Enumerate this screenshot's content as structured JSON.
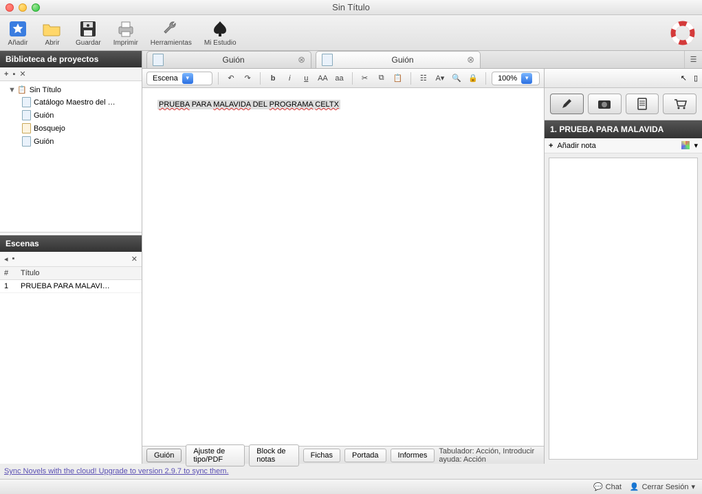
{
  "window": {
    "title": "Sin Título"
  },
  "toolbar": {
    "add": "Añadir",
    "open": "Abrir",
    "save": "Guardar",
    "print": "Imprimir",
    "tools": "Herramientas",
    "studio": "Mi Estudio"
  },
  "sidebar": {
    "projects_header": "Biblioteca de proyectos",
    "tree": {
      "root": "Sin Título",
      "items": [
        "Catálogo Maestro del …",
        "Guión",
        "Bosquejo",
        "Guión"
      ]
    },
    "scenes_header": "Escenas",
    "scenes": {
      "col_num": "#",
      "col_title": "Título",
      "rows": [
        {
          "n": "1",
          "title": "PRUEBA PARA MALAVI…"
        }
      ]
    }
  },
  "tabs": [
    {
      "label": "Guión"
    },
    {
      "label": "Guión"
    }
  ],
  "format": {
    "element_type": "Escena",
    "zoom": "100%"
  },
  "document": {
    "scene_words": [
      "PRUEBA",
      "PARA",
      "MALAVIDA",
      "DEL",
      "PROGRAMA",
      "CELTX"
    ]
  },
  "bottom_tabs": {
    "items": [
      "Guión",
      "Ajuste de tipo/PDF",
      "Block de notas",
      "Fichas",
      "Portada",
      "Informes"
    ],
    "hint": "Tabulador: Acción, Introducir ayuda: Acción"
  },
  "right": {
    "scene_title": "1. PRUEBA PARA MALAVIDA",
    "add_note": "Añadir nota"
  },
  "footer": {
    "sync_link": "Sync Novels with the cloud! Upgrade to version 2.9.7 to sync them."
  },
  "status": {
    "chat": "Chat",
    "session": "Cerrar Sesión"
  }
}
